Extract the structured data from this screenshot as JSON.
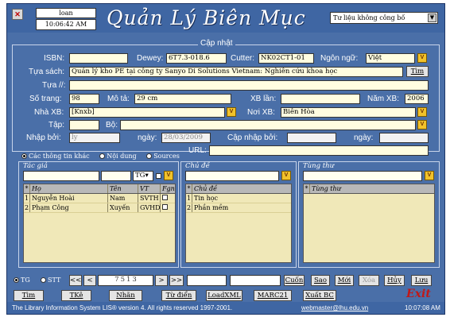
{
  "header": {
    "user": "loan",
    "time": "10:06:42 AM",
    "title": "Quản Lý Biên Mục",
    "collection_select": "Tư liệu không công bố"
  },
  "group_title": "Cập nhật",
  "form": {
    "isbn_label": "ISBN:",
    "isbn": "",
    "dewey_label": "Dewey:",
    "dewey": "6T7.3-018.6",
    "cutter_label": "Cutter:",
    "cutter": "NK02CT1-01",
    "language_label": "Ngôn ngữ:",
    "language": "Việt",
    "title_label": "Tựa sách:",
    "title": "Quản lý kho PE tại công ty Sanyo Di Solutions Vietnam: Nghiên cứu khoa học",
    "tim_button": "Tìm",
    "subtitle_label": "Tựa //:",
    "subtitle": "",
    "pages_label": "Số trang:",
    "pages": "98",
    "desc_label": "Mô tả:",
    "desc": "29 cm",
    "edition_label": "XB lần:",
    "edition": "",
    "year_label": "Năm XB:",
    "year": "2006",
    "publisher_label": "Nhà XB:",
    "publisher": "[Knxb]",
    "place_label": "Nơi XB:",
    "place": "Biên Hòa",
    "volume_label": "Tập:",
    "volume": "",
    "set_label": "Bộ:",
    "set": "",
    "entered_by_label": "Nhập bởi:",
    "entered_by": "ly",
    "date_label": "ngày:",
    "date": "28/03/2009",
    "updated_by_label": "Cập nhập bởi:",
    "updated_by": "",
    "date2_label": "ngày:",
    "date2": "",
    "url_label": "URL:",
    "url": ""
  },
  "radios": [
    {
      "label": "Các thông tin khác",
      "checked": true
    },
    {
      "label": "Nội dung",
      "checked": false
    },
    {
      "label": "Sources",
      "checked": false
    }
  ],
  "authors": {
    "title": "Tác giả",
    "type_select": "TG",
    "headers": [
      "Họ",
      "Tên",
      "VT",
      "Fgn"
    ],
    "rows": [
      {
        "n": "1",
        "ho": "Nguyễn Hoài",
        "ten": "Nam",
        "vt": "SVTH"
      },
      {
        "n": "2",
        "ho": "Phạm Công",
        "ten": "Xuyến",
        "vt": "GVHD"
      }
    ]
  },
  "subjects": {
    "title": "Chủ đề",
    "header": "Chủ đề",
    "rows": [
      {
        "n": "1",
        "name": "Tin học"
      },
      {
        "n": "2",
        "name": "Phần mềm"
      }
    ]
  },
  "series": {
    "title": "Tùng thư",
    "header": "Tùng thư"
  },
  "nav": {
    "opt_tg": "TG",
    "opt_stt": "STT",
    "first": "<<",
    "prev": "<",
    "record": "7513",
    "next": ">",
    "last": ">>",
    "cuon": "Cuốn",
    "sao": "Sao",
    "moi": "Mới",
    "xoa": "Xóa",
    "huy": "Hủy",
    "luu": "Lưu"
  },
  "bottom_buttons": [
    "Tìm",
    "TKê",
    "Nhãn",
    "Từ điển",
    "LoadXML",
    "MARC21",
    "Xuất BC"
  ],
  "exit": "Exit",
  "status": {
    "copyright": "The Library Information System LIS® version 4. All rights reserved 1997-2001.",
    "email": "webmaster@lhu.edu.vn",
    "time": "10:07:08 AM"
  },
  "colors": {
    "background": "#4a6fa8",
    "field": "#fffde0",
    "accent": "#f1c22b"
  }
}
